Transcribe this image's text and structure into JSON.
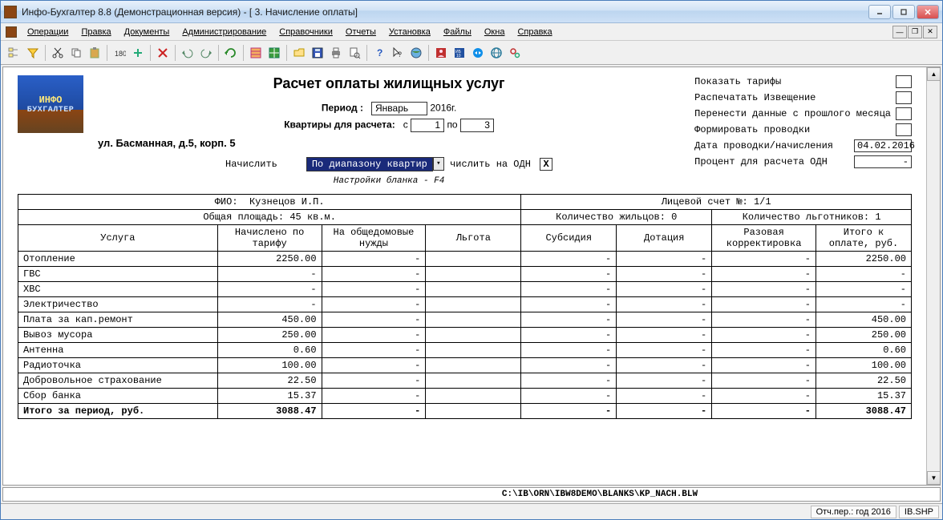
{
  "window": {
    "title": "Инфо-Бухгалтер 8.8 (Демонстрационная версия) - [   3. Начисление оплаты]"
  },
  "menu": {
    "operations": "Операции",
    "edit": "Правка",
    "documents": "Документы",
    "admin": "Администрирование",
    "refs": "Справочники",
    "reports": "Отчеты",
    "install": "Установка",
    "files": "Файлы",
    "windows": "Окна",
    "help": "Справка"
  },
  "logo": {
    "line1": "ИНФО",
    "line2": "БУХГАЛТЕР"
  },
  "doc": {
    "title": "Расчет оплаты жилищных услуг",
    "period_label": "Период :",
    "period_month": "Январь",
    "period_year": "2016г.",
    "flats_label": "Квартиры для расчета:",
    "from_label": "с",
    "from_value": "1",
    "to_label": "по",
    "to_value": "3",
    "address": "ул. Басманная, д.5, корп. 5",
    "calc_label": "Начислить",
    "calc_mode": "По диапазону квартир",
    "odn_label": "числить на ОДН",
    "odn_value": "X",
    "hint": "Настройки бланка - F4"
  },
  "side": {
    "show_tariffs": "Показать тарифы",
    "print_notice": "Распечатать Извещение",
    "carry_over": "Перенести данные с прошлого месяца",
    "form_entries": "Формировать проводки",
    "posting_date_label": "Дата проводки/начисления",
    "posting_date": "04.02.2016",
    "odn_percent_label": "Процент для расчета ОДН",
    "odn_percent": "-"
  },
  "tableHeader": {
    "fio_label": "ФИО:",
    "fio": "Кузнецов И.П.",
    "account_label": "Лицевой счет №:",
    "account": "1/1",
    "area_label": "Общая площадь:",
    "area": "45 кв.м.",
    "residents_label": "Количество жильцов:",
    "residents": "0",
    "beneficiaries_label": "Количество льготников:",
    "beneficiaries": "1"
  },
  "columns": {
    "service": "Услуга",
    "by_tariff": "Начислено по тарифу",
    "common_needs": "На общедомовые нужды",
    "benefit": "Льгота",
    "subsidy": "Субсидия",
    "dotation": "Дотация",
    "onetime": "Разовая корректировка",
    "total": "Итого к оплате, руб."
  },
  "rows": [
    {
      "name": "Отопление",
      "tariff": "2250.00",
      "common": "-",
      "benefit": "",
      "subsidy": "-",
      "dotation": "-",
      "onetime": "-",
      "total": "2250.00"
    },
    {
      "name": "ГВС",
      "tariff": "-",
      "common": "-",
      "benefit": "",
      "subsidy": "-",
      "dotation": "-",
      "onetime": "-",
      "total": "-"
    },
    {
      "name": "ХВС",
      "tariff": "-",
      "common": "-",
      "benefit": "",
      "subsidy": "-",
      "dotation": "-",
      "onetime": "-",
      "total": "-"
    },
    {
      "name": "Электричество",
      "tariff": "-",
      "common": "-",
      "benefit": "",
      "subsidy": "-",
      "dotation": "-",
      "onetime": "-",
      "total": "-"
    },
    {
      "name": "Плата за кап.ремонт",
      "tariff": "450.00",
      "common": "-",
      "benefit": "",
      "subsidy": "-",
      "dotation": "-",
      "onetime": "-",
      "total": "450.00"
    },
    {
      "name": "Вывоз мусора",
      "tariff": "250.00",
      "common": "-",
      "benefit": "",
      "subsidy": "-",
      "dotation": "-",
      "onetime": "-",
      "total": "250.00"
    },
    {
      "name": "Антенна",
      "tariff": "0.60",
      "common": "-",
      "benefit": "",
      "subsidy": "-",
      "dotation": "-",
      "onetime": "-",
      "total": "0.60"
    },
    {
      "name": "Радиоточка",
      "tariff": "100.00",
      "common": "-",
      "benefit": "",
      "subsidy": "-",
      "dotation": "-",
      "onetime": "-",
      "total": "100.00"
    },
    {
      "name": "Добровольное страхование",
      "tariff": "22.50",
      "common": "-",
      "benefit": "",
      "subsidy": "-",
      "dotation": "-",
      "onetime": "-",
      "total": "22.50"
    },
    {
      "name": "Сбор банка",
      "tariff": "15.37",
      "common": "-",
      "benefit": "",
      "subsidy": "-",
      "dotation": "-",
      "onetime": "-",
      "total": "15.37"
    }
  ],
  "totals": {
    "label": "Итого за период, руб.",
    "tariff": "3088.47",
    "common": "-",
    "benefit": "",
    "subsidy": "-",
    "dotation": "-",
    "onetime": "-",
    "total": "3088.47"
  },
  "docstatus": {
    "path": "C:\\IB\\ORN\\IBW8DEMO\\BLANKS\\KP_NACH.BLW"
  },
  "status": {
    "period": "Отч.пер.: год 2016",
    "file": "IB.SHP"
  }
}
